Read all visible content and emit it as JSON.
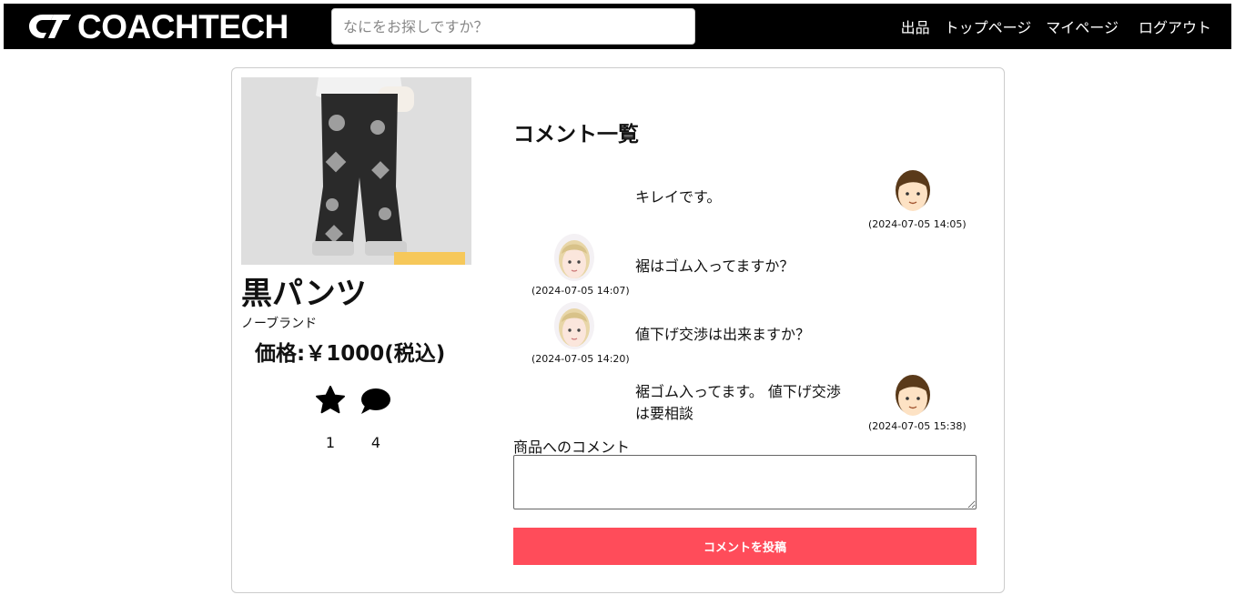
{
  "header": {
    "logo_text": "COACHTECH",
    "search_placeholder": "なにをお探しですか？",
    "nav": {
      "sell": "出品",
      "top": "トップページ",
      "mypage": "マイページ",
      "logout": "ログアウト"
    }
  },
  "product": {
    "name": "黒パンツ",
    "brand": "ノーブランド",
    "price": "価格:￥1000(税込)",
    "favorites": "1",
    "comments": "4"
  },
  "comments": {
    "heading": "コメント一覧",
    "items": [
      {
        "text": "キレイです。",
        "time": "(2024-07-05 14:05)",
        "side": "right",
        "avatar": "male-avatar"
      },
      {
        "text": "裾はゴム入ってますか？",
        "time": "(2024-07-05 14:07)",
        "side": "left",
        "avatar": "female-avatar"
      },
      {
        "text": "値下げ交渉は出来ますか？",
        "time": "(2024-07-05 14:20)",
        "side": "left",
        "avatar": "female-avatar"
      },
      {
        "text": "裾ゴム入ってます。 値下げ交渉は要相談",
        "time": "(2024-07-05 15:38)",
        "side": "right",
        "avatar": "male-avatar"
      }
    ]
  },
  "form": {
    "label": "商品へのコメント",
    "submit": "コメントを投稿"
  },
  "colors": {
    "header_bg": "#000000",
    "submit_bg": "#ff4c5a"
  }
}
